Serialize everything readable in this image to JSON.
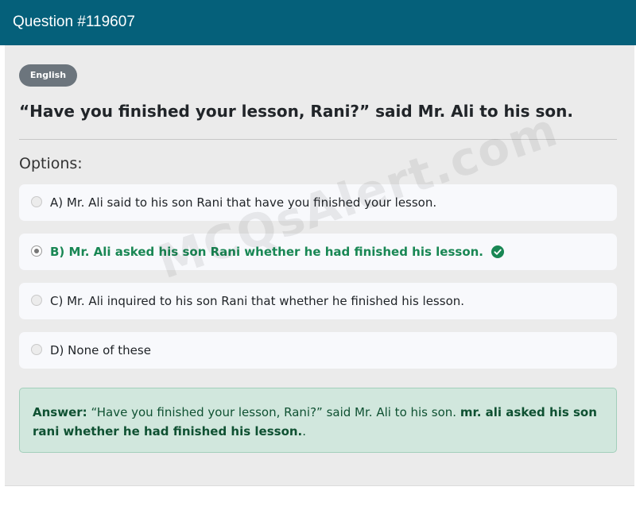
{
  "header": {
    "title": "Question #119607"
  },
  "badge": {
    "language": "English"
  },
  "question": {
    "text": "“Have you finished your lesson, Rani?” said Mr. Ali to his son."
  },
  "options_label": "Options:",
  "options": [
    {
      "text": "A) Mr. Ali said to his son Rani that have you finished your lesson.",
      "selected": false,
      "correct": false
    },
    {
      "text": "B) Mr. Ali asked his son Rani whether he had finished his lesson.",
      "selected": true,
      "correct": true
    },
    {
      "text": "C) Mr. Ali inquired to his son Rani that whether he finished his lesson.",
      "selected": false,
      "correct": false
    },
    {
      "text": "D) None of these",
      "selected": false,
      "correct": false
    }
  ],
  "answer": {
    "label": "Answer:",
    "question_text": "“Have you finished your lesson, Rani?” said Mr. Ali to his son.",
    "answer_text": "mr. ali asked his son rani whether he had finished his lesson.",
    "trailing": "."
  },
  "watermark": "MCQsAlert.com",
  "colors": {
    "header": "#05607a",
    "correct": "#198754",
    "answer_bg": "#d1e7dd"
  },
  "icons": {
    "correct_option": "check-circle-icon"
  }
}
